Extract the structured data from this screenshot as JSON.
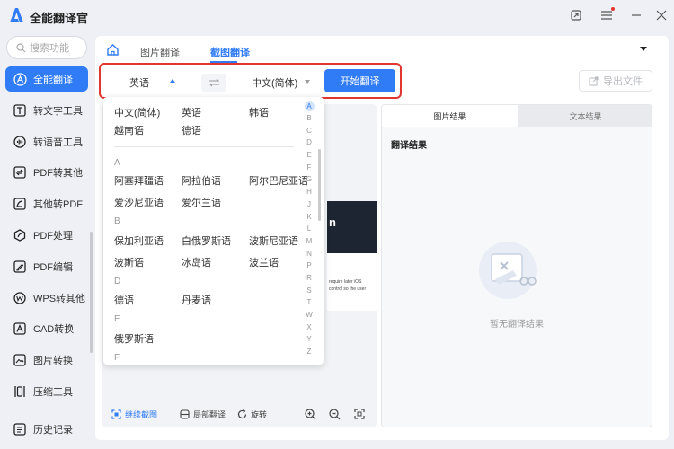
{
  "app": {
    "title": "全能翻译官"
  },
  "sidebar": {
    "search_placeholder": "搜索功能",
    "items": [
      {
        "label": "全能翻译",
        "icon": "translate-icon"
      },
      {
        "label": "转文字工具",
        "icon": "text-icon"
      },
      {
        "label": "转语音工具",
        "icon": "audio-icon"
      },
      {
        "label": "PDF转其他",
        "icon": "pdf-convert-icon"
      },
      {
        "label": "其他转PDF",
        "icon": "to-pdf-icon"
      },
      {
        "label": "PDF处理",
        "icon": "pdf-process-icon"
      },
      {
        "label": "PDF编辑",
        "icon": "pdf-edit-icon"
      },
      {
        "label": "WPS转其他",
        "icon": "wps-icon"
      },
      {
        "label": "CAD转换",
        "icon": "cad-icon"
      },
      {
        "label": "图片转换",
        "icon": "image-icon"
      },
      {
        "label": "压缩工具",
        "icon": "compress-icon"
      }
    ],
    "history": "历史记录"
  },
  "tabs": {
    "image_translate": "图片翻译",
    "screenshot_translate": "截图翻译"
  },
  "toolbar": {
    "source_lang": "英语",
    "target_lang": "中文(简体)",
    "start_button": "开始翻译",
    "export_button": "导出文件"
  },
  "dropdown": {
    "common": [
      "中文(简体)",
      "英语",
      "韩语",
      "越南语",
      "德语"
    ],
    "groups": [
      {
        "letter": "A",
        "langs": [
          "阿塞拜疆语",
          "阿拉伯语",
          "阿尔巴尼亚语",
          "爱沙尼亚语",
          "爱尔兰语"
        ]
      },
      {
        "letter": "B",
        "langs": [
          "保加利亚语",
          "白俄罗斯语",
          "波斯尼亚语",
          "波斯语",
          "冰岛语",
          "波兰语"
        ]
      },
      {
        "letter": "D",
        "langs": [
          "德语",
          "丹麦语"
        ]
      },
      {
        "letter": "E",
        "langs": [
          "俄罗斯语"
        ]
      },
      {
        "letter": "F",
        "langs": []
      }
    ],
    "alphabet": [
      "A",
      "B",
      "C",
      "D",
      "E",
      "F",
      "G",
      "H",
      "J",
      "K",
      "L",
      "M",
      "N",
      "P",
      "R",
      "S",
      "T",
      "W",
      "X",
      "Y",
      "Z"
    ]
  },
  "preview": {
    "dark_text": "n",
    "small_text": [
      "require later iOS",
      "control so the user"
    ]
  },
  "bottom_tools": {
    "continue": "继续截图",
    "partial": "局部翻译",
    "rotate": "旋转"
  },
  "result": {
    "tab_image": "图片结果",
    "tab_text": "文本结果",
    "title": "翻译结果",
    "empty": "暂无翻译结果"
  },
  "colors": {
    "accent": "#2f7cf6",
    "highlight": "#e0362f"
  }
}
